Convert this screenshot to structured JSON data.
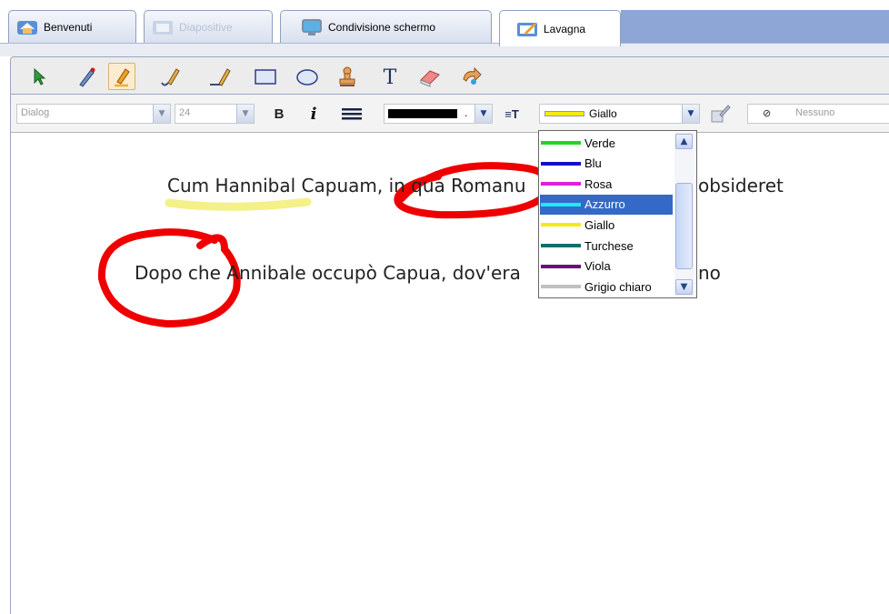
{
  "tabs": [
    {
      "label": "Benvenuti",
      "icon": "home-icon",
      "state": "normal"
    },
    {
      "label": "Diapositive",
      "icon": "slides-icon",
      "state": "disabled"
    },
    {
      "label": "Condivisione schermo",
      "icon": "monitor-icon",
      "state": "normal"
    },
    {
      "label": "Lavagna",
      "icon": "whiteboard-icon",
      "state": "active"
    }
  ],
  "toolbar": {
    "tools": [
      "select-arrow-icon",
      "pen-icon",
      "highlighter-icon",
      "curve-pen-icon",
      "line-pen-icon",
      "rectangle-icon",
      "ellipse-icon",
      "stamp-icon",
      "text-tool-icon",
      "eraser-icon",
      "undo-icon"
    ],
    "selected_tool": "highlighter-icon"
  },
  "format_bar": {
    "font_family": "Dialog",
    "font_size": "24",
    "bold_label": "B",
    "italic_label": "i",
    "line_color_value": "#000000",
    "line_color_suffix": ".",
    "text_color_label": "≡T",
    "highlight_color": "Giallo",
    "fill_label": "Nessuno",
    "fill_prefix": "⊘"
  },
  "canvas": {
    "line1": "Cum Hannibal Capuam, in qua Romanu",
    "line1_tail": "obsideret",
    "line2": "Dopo che Annibale occupò Capua, dov'era",
    "line2_tail": "no"
  },
  "dropdown": {
    "options": [
      {
        "name": "Verde",
        "color": "#22d622"
      },
      {
        "name": "Blu",
        "color": "#1010c8"
      },
      {
        "name": "Rosa",
        "color": "#e020d8"
      },
      {
        "name": "Azzurro",
        "color": "#20e8f0"
      },
      {
        "name": "Giallo",
        "color": "#f4ea10"
      },
      {
        "name": "Turchese",
        "color": "#0f6e6e"
      },
      {
        "name": "Viola",
        "color": "#6a0f7a"
      },
      {
        "name": "Grigio chiaro",
        "color": "#c0c0c0"
      }
    ],
    "selected": "Azzurro"
  },
  "colors": {
    "accent": "#3569c7",
    "annotation_red": "#ee0000",
    "highlight_yellow": "#f4f08a",
    "header_blue": "#8ea6d6"
  }
}
